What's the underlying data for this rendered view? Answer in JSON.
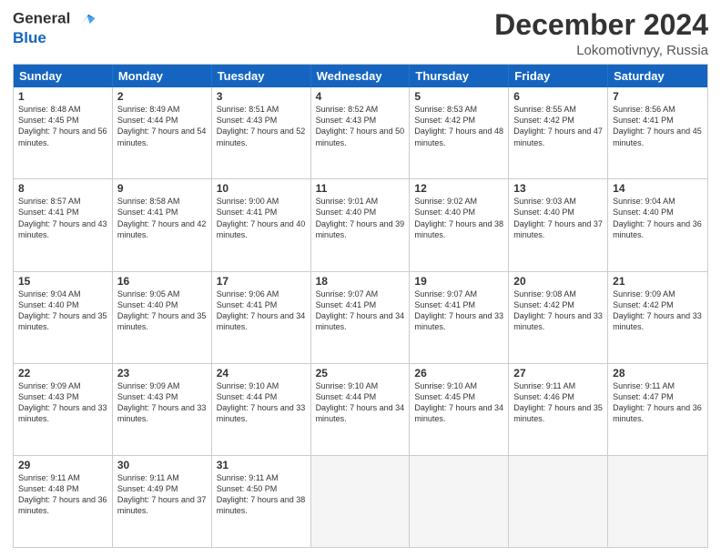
{
  "header": {
    "logo_line1": "General",
    "logo_line2": "Blue",
    "month_year": "December 2024",
    "location": "Lokomotivnyy, Russia"
  },
  "days_of_week": [
    "Sunday",
    "Monday",
    "Tuesday",
    "Wednesday",
    "Thursday",
    "Friday",
    "Saturday"
  ],
  "weeks": [
    [
      {
        "day": "1",
        "sunrise": "Sunrise: 8:48 AM",
        "sunset": "Sunset: 4:45 PM",
        "daylight": "Daylight: 7 hours and 56 minutes."
      },
      {
        "day": "2",
        "sunrise": "Sunrise: 8:49 AM",
        "sunset": "Sunset: 4:44 PM",
        "daylight": "Daylight: 7 hours and 54 minutes."
      },
      {
        "day": "3",
        "sunrise": "Sunrise: 8:51 AM",
        "sunset": "Sunset: 4:43 PM",
        "daylight": "Daylight: 7 hours and 52 minutes."
      },
      {
        "day": "4",
        "sunrise": "Sunrise: 8:52 AM",
        "sunset": "Sunset: 4:43 PM",
        "daylight": "Daylight: 7 hours and 50 minutes."
      },
      {
        "day": "5",
        "sunrise": "Sunrise: 8:53 AM",
        "sunset": "Sunset: 4:42 PM",
        "daylight": "Daylight: 7 hours and 48 minutes."
      },
      {
        "day": "6",
        "sunrise": "Sunrise: 8:55 AM",
        "sunset": "Sunset: 4:42 PM",
        "daylight": "Daylight: 7 hours and 47 minutes."
      },
      {
        "day": "7",
        "sunrise": "Sunrise: 8:56 AM",
        "sunset": "Sunset: 4:41 PM",
        "daylight": "Daylight: 7 hours and 45 minutes."
      }
    ],
    [
      {
        "day": "8",
        "sunrise": "Sunrise: 8:57 AM",
        "sunset": "Sunset: 4:41 PM",
        "daylight": "Daylight: 7 hours and 43 minutes."
      },
      {
        "day": "9",
        "sunrise": "Sunrise: 8:58 AM",
        "sunset": "Sunset: 4:41 PM",
        "daylight": "Daylight: 7 hours and 42 minutes."
      },
      {
        "day": "10",
        "sunrise": "Sunrise: 9:00 AM",
        "sunset": "Sunset: 4:41 PM",
        "daylight": "Daylight: 7 hours and 40 minutes."
      },
      {
        "day": "11",
        "sunrise": "Sunrise: 9:01 AM",
        "sunset": "Sunset: 4:40 PM",
        "daylight": "Daylight: 7 hours and 39 minutes."
      },
      {
        "day": "12",
        "sunrise": "Sunrise: 9:02 AM",
        "sunset": "Sunset: 4:40 PM",
        "daylight": "Daylight: 7 hours and 38 minutes."
      },
      {
        "day": "13",
        "sunrise": "Sunrise: 9:03 AM",
        "sunset": "Sunset: 4:40 PM",
        "daylight": "Daylight: 7 hours and 37 minutes."
      },
      {
        "day": "14",
        "sunrise": "Sunrise: 9:04 AM",
        "sunset": "Sunset: 4:40 PM",
        "daylight": "Daylight: 7 hours and 36 minutes."
      }
    ],
    [
      {
        "day": "15",
        "sunrise": "Sunrise: 9:04 AM",
        "sunset": "Sunset: 4:40 PM",
        "daylight": "Daylight: 7 hours and 35 minutes."
      },
      {
        "day": "16",
        "sunrise": "Sunrise: 9:05 AM",
        "sunset": "Sunset: 4:40 PM",
        "daylight": "Daylight: 7 hours and 35 minutes."
      },
      {
        "day": "17",
        "sunrise": "Sunrise: 9:06 AM",
        "sunset": "Sunset: 4:41 PM",
        "daylight": "Daylight: 7 hours and 34 minutes."
      },
      {
        "day": "18",
        "sunrise": "Sunrise: 9:07 AM",
        "sunset": "Sunset: 4:41 PM",
        "daylight": "Daylight: 7 hours and 34 minutes."
      },
      {
        "day": "19",
        "sunrise": "Sunrise: 9:07 AM",
        "sunset": "Sunset: 4:41 PM",
        "daylight": "Daylight: 7 hours and 33 minutes."
      },
      {
        "day": "20",
        "sunrise": "Sunrise: 9:08 AM",
        "sunset": "Sunset: 4:42 PM",
        "daylight": "Daylight: 7 hours and 33 minutes."
      },
      {
        "day": "21",
        "sunrise": "Sunrise: 9:09 AM",
        "sunset": "Sunset: 4:42 PM",
        "daylight": "Daylight: 7 hours and 33 minutes."
      }
    ],
    [
      {
        "day": "22",
        "sunrise": "Sunrise: 9:09 AM",
        "sunset": "Sunset: 4:43 PM",
        "daylight": "Daylight: 7 hours and 33 minutes."
      },
      {
        "day": "23",
        "sunrise": "Sunrise: 9:09 AM",
        "sunset": "Sunset: 4:43 PM",
        "daylight": "Daylight: 7 hours and 33 minutes."
      },
      {
        "day": "24",
        "sunrise": "Sunrise: 9:10 AM",
        "sunset": "Sunset: 4:44 PM",
        "daylight": "Daylight: 7 hours and 33 minutes."
      },
      {
        "day": "25",
        "sunrise": "Sunrise: 9:10 AM",
        "sunset": "Sunset: 4:44 PM",
        "daylight": "Daylight: 7 hours and 34 minutes."
      },
      {
        "day": "26",
        "sunrise": "Sunrise: 9:10 AM",
        "sunset": "Sunset: 4:45 PM",
        "daylight": "Daylight: 7 hours and 34 minutes."
      },
      {
        "day": "27",
        "sunrise": "Sunrise: 9:11 AM",
        "sunset": "Sunset: 4:46 PM",
        "daylight": "Daylight: 7 hours and 35 minutes."
      },
      {
        "day": "28",
        "sunrise": "Sunrise: 9:11 AM",
        "sunset": "Sunset: 4:47 PM",
        "daylight": "Daylight: 7 hours and 36 minutes."
      }
    ],
    [
      {
        "day": "29",
        "sunrise": "Sunrise: 9:11 AM",
        "sunset": "Sunset: 4:48 PM",
        "daylight": "Daylight: 7 hours and 36 minutes."
      },
      {
        "day": "30",
        "sunrise": "Sunrise: 9:11 AM",
        "sunset": "Sunset: 4:49 PM",
        "daylight": "Daylight: 7 hours and 37 minutes."
      },
      {
        "day": "31",
        "sunrise": "Sunrise: 9:11 AM",
        "sunset": "Sunset: 4:50 PM",
        "daylight": "Daylight: 7 hours and 38 minutes."
      },
      null,
      null,
      null,
      null
    ]
  ]
}
